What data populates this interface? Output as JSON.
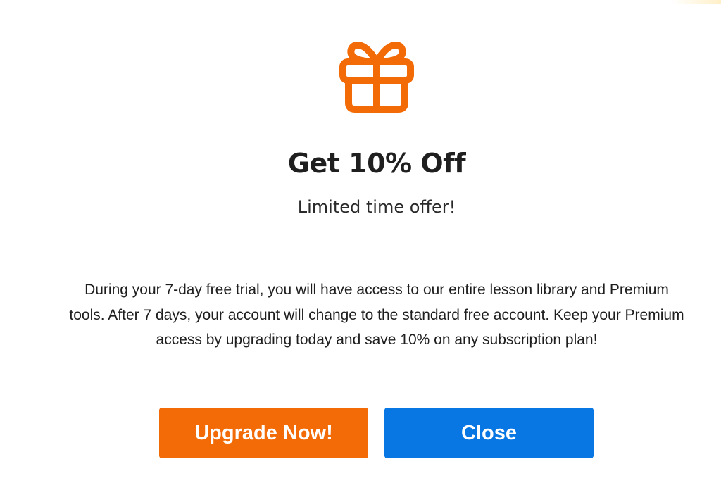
{
  "offer": {
    "title": "Get 10% Off",
    "subtitle": "Limited time offer!",
    "description": "During your 7-day free trial, you will have access to our entire lesson library and Premium tools. After 7 days, your account will change to the standard free account. Keep your Premium access by upgrading today and save 10% on any subscription plan!",
    "icon": "gift-icon"
  },
  "buttons": {
    "upgrade_label": "Upgrade Now!",
    "close_label": "Close"
  },
  "colors": {
    "accent_orange": "#f26b06",
    "primary_blue": "#0877e3",
    "text_dark": "#1f1f1f"
  }
}
